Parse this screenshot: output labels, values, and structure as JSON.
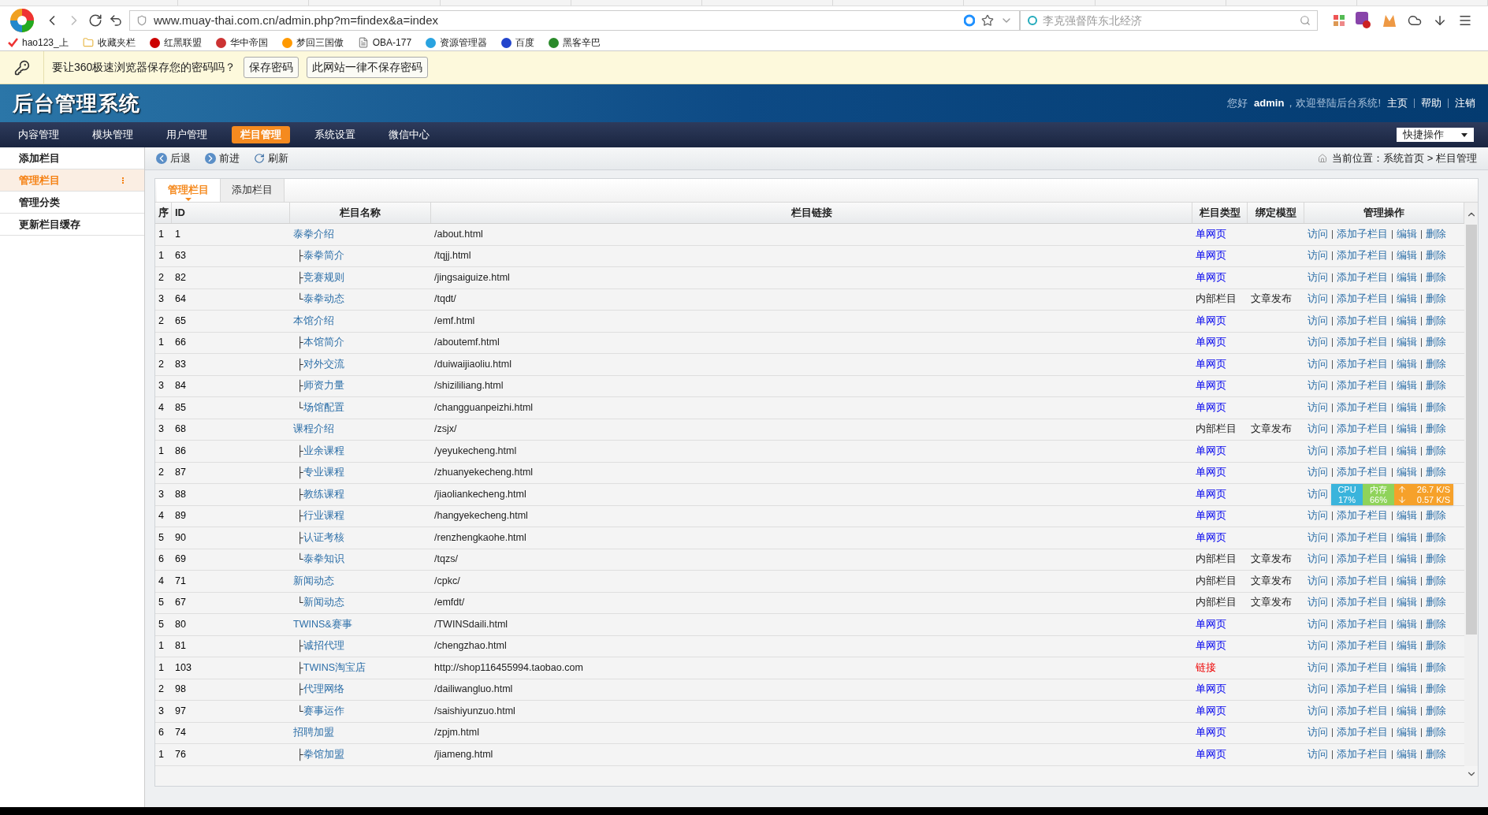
{
  "browser": {
    "url": "www.muay-thai.com.cn/admin.php?m=findex&a=index",
    "search": {
      "placeholder": "李克强督阵东北经济"
    },
    "bookmarks": [
      "hao123_上",
      "收藏夹栏",
      "红黑联盟",
      "华中帝国",
      "梦回三国傲",
      "OBA-177",
      "资源管理器",
      "百度",
      "黑客辛巴"
    ],
    "password_bar": {
      "message": "要让360极速浏览器保存您的密码吗？",
      "buttons": [
        "保存密码",
        "此网站一律不保存密码"
      ]
    }
  },
  "header": {
    "logo": "后台管理系统",
    "greeting": "您好",
    "user": "admin",
    "welcome": "，欢迎登陆后台系统!",
    "links": [
      "主页",
      "帮助",
      "注销"
    ]
  },
  "menu": [
    {
      "label": "内容管理",
      "selected": false
    },
    {
      "label": "模块管理",
      "selected": false
    },
    {
      "label": "用户管理",
      "selected": false
    },
    {
      "label": "栏目管理",
      "selected": true
    },
    {
      "label": "系统设置",
      "selected": false
    },
    {
      "label": "微信中心",
      "selected": false
    }
  ],
  "quick_action": "快捷操作",
  "sidebar": [
    {
      "label": "添加栏目",
      "selected": false
    },
    {
      "label": "管理栏目",
      "selected": true
    },
    {
      "label": "管理分类",
      "selected": false
    },
    {
      "label": "更新栏目缓存",
      "selected": false
    }
  ],
  "toolbar": {
    "buttons": [
      {
        "kind": "back",
        "label": "后退"
      },
      {
        "kind": "forward",
        "label": "前进"
      },
      {
        "kind": "refresh",
        "label": "刷新"
      }
    ],
    "breadcrumb": "当前位置：系统首页 > 栏目管理"
  },
  "tabs": [
    {
      "label": "管理栏目",
      "selected": true
    },
    {
      "label": "添加栏目",
      "selected": false
    }
  ],
  "table": {
    "columns": [
      "序",
      "ID",
      "栏目名称",
      "栏目链接",
      "栏目类型",
      "绑定模型",
      "管理操作"
    ],
    "rows": [
      {
        "seq": "1",
        "id": "1",
        "name": "泰拳介绍",
        "link": "/about.html",
        "type": {
          "text": "单网页",
          "kind": "page"
        },
        "actions": [
          "访问",
          "添加子栏目",
          "编辑",
          "删除"
        ],
        "children": [
          {
            "seq": "1",
            "id": "63",
            "name": "泰拳简介",
            "link": "/tqjj.html",
            "connector": "├",
            "type": {
              "text": "单网页",
              "kind": "page"
            },
            "actions": [
              "访问",
              "添加子栏目",
              "编辑",
              "删除"
            ]
          },
          {
            "seq": "2",
            "id": "82",
            "name": "竞赛规则",
            "link": "/jingsaiguize.html",
            "connector": "├",
            "type": {
              "text": "单网页",
              "kind": "page"
            },
            "actions": [
              "访问",
              "添加子栏目",
              "编辑",
              "删除"
            ]
          },
          {
            "seq": "3",
            "id": "64",
            "name": "泰拳动态",
            "link": "/tqdt/",
            "connector": "└",
            "type": {
              "text": "内部栏目",
              "kind": "internal"
            },
            "model": "文章发布",
            "actions": [
              "访问",
              "添加子栏目",
              "编辑",
              "删除"
            ]
          }
        ]
      },
      {
        "seq": "2",
        "id": "65",
        "name": "本馆介绍",
        "link": "/emf.html",
        "type": {
          "text": "单网页",
          "kind": "page"
        },
        "actions": [
          "访问",
          "添加子栏目",
          "编辑",
          "删除"
        ],
        "children": [
          {
            "seq": "1",
            "id": "66",
            "name": "本馆简介",
            "link": "/aboutemf.html",
            "connector": "├",
            "type": {
              "text": "单网页",
              "kind": "page"
            },
            "actions": [
              "访问",
              "添加子栏目",
              "编辑",
              "删除"
            ]
          },
          {
            "seq": "2",
            "id": "83",
            "name": "对外交流",
            "link": "/duiwaijiaoliu.html",
            "connector": "├",
            "type": {
              "text": "单网页",
              "kind": "page"
            },
            "actions": [
              "访问",
              "添加子栏目",
              "编辑",
              "删除"
            ]
          },
          {
            "seq": "3",
            "id": "84",
            "name": "师资力量",
            "link": "/shizililiang.html",
            "connector": "├",
            "type": {
              "text": "单网页",
              "kind": "page"
            },
            "actions": [
              "访问",
              "添加子栏目",
              "编辑",
              "删除"
            ]
          },
          {
            "seq": "4",
            "id": "85",
            "name": "场馆配置",
            "link": "/changguanpeizhi.html",
            "connector": "└",
            "type": {
              "text": "单网页",
              "kind": "page"
            },
            "actions": [
              "访问",
              "添加子栏目",
              "编辑",
              "删除"
            ]
          }
        ]
      },
      {
        "seq": "3",
        "id": "68",
        "name": "课程介绍",
        "link": "/zsjx/",
        "type": {
          "text": "内部栏目",
          "kind": "internal"
        },
        "model": "文章发布",
        "actions": [
          "访问",
          "添加子栏目",
          "编辑",
          "删除"
        ],
        "children": [
          {
            "seq": "1",
            "id": "86",
            "name": "业余课程",
            "link": "/yeyukecheng.html",
            "connector": "├",
            "type": {
              "text": "单网页",
              "kind": "page"
            },
            "actions": [
              "访问",
              "添加子栏目",
              "编辑",
              "删除"
            ]
          },
          {
            "seq": "2",
            "id": "87",
            "name": "专业课程",
            "link": "/zhuanyekecheng.html",
            "connector": "├",
            "type": {
              "text": "单网页",
              "kind": "page"
            },
            "actions": [
              "访问",
              "添加子栏目",
              "编辑",
              "删除"
            ]
          },
          {
            "seq": "3",
            "id": "88",
            "name": "教练课程",
            "link": "/jiaoliankecheng.html",
            "connector": "├",
            "type": {
              "text": "单网页",
              "kind": "page"
            },
            "actions": [
              "访问"
            ]
          },
          {
            "seq": "4",
            "id": "89",
            "name": "行业课程",
            "link": "/hangyekecheng.html",
            "connector": "├",
            "type": {
              "text": "单网页",
              "kind": "page"
            },
            "actions": [
              "访问",
              "添加子栏目",
              "编辑",
              "删除"
            ]
          },
          {
            "seq": "5",
            "id": "90",
            "name": "认证考核",
            "link": "/renzhengkaohe.html",
            "connector": "├",
            "type": {
              "text": "单网页",
              "kind": "page"
            },
            "actions": [
              "访问",
              "添加子栏目",
              "编辑",
              "删除"
            ]
          },
          {
            "seq": "6",
            "id": "69",
            "name": "泰拳知识",
            "link": "/tqzs/",
            "connector": "└",
            "type": {
              "text": "内部栏目",
              "kind": "internal"
            },
            "model": "文章发布",
            "actions": [
              "访问",
              "添加子栏目",
              "编辑",
              "删除"
            ]
          }
        ]
      },
      {
        "seq": "4",
        "id": "71",
        "name": "新闻动态",
        "link": "/cpkc/",
        "type": {
          "text": "内部栏目",
          "kind": "internal"
        },
        "model": "文章发布",
        "actions": [
          "访问",
          "添加子栏目",
          "编辑",
          "删除"
        ],
        "children": [
          {
            "seq": "5",
            "id": "67",
            "name": "新闻动态",
            "link": "/emfdt/",
            "connector": "└",
            "type": {
              "text": "内部栏目",
              "kind": "internal"
            },
            "model": "文章发布",
            "actions": [
              "访问",
              "添加子栏目",
              "编辑",
              "删除"
            ]
          }
        ]
      },
      {
        "seq": "5",
        "id": "80",
        "name": "TWINS&赛事",
        "link": "/TWINSdaili.html",
        "type": {
          "text": "单网页",
          "kind": "page"
        },
        "actions": [
          "访问",
          "添加子栏目",
          "编辑",
          "删除"
        ],
        "children": [
          {
            "seq": "1",
            "id": "81",
            "name": "诚招代理",
            "link": "/chengzhao.html",
            "connector": "├",
            "type": {
              "text": "单网页",
              "kind": "page"
            },
            "actions": [
              "访问",
              "添加子栏目",
              "编辑",
              "删除"
            ]
          },
          {
            "seq": "1",
            "id": "103",
            "name": "TWINS淘宝店",
            "link": "http://shop116455994.taobao.com",
            "connector": "├",
            "type": {
              "text": "链接",
              "kind": "link"
            },
            "actions": [
              "访问",
              "添加子栏目",
              "编辑",
              "删除"
            ]
          },
          {
            "seq": "2",
            "id": "98",
            "name": "代理网络",
            "link": "/dailiwangluo.html",
            "connector": "├",
            "type": {
              "text": "单网页",
              "kind": "page"
            },
            "actions": [
              "访问",
              "添加子栏目",
              "编辑",
              "删除"
            ]
          },
          {
            "seq": "3",
            "id": "97",
            "name": "赛事运作",
            "link": "/saishiyunzuo.html",
            "connector": "└",
            "type": {
              "text": "单网页",
              "kind": "page"
            },
            "actions": [
              "访问",
              "添加子栏目",
              "编辑",
              "删除"
            ]
          }
        ]
      },
      {
        "seq": "6",
        "id": "74",
        "name": "招聘加盟",
        "link": "/zpjm.html",
        "type": {
          "text": "单网页",
          "kind": "page"
        },
        "actions": [
          "访问",
          "添加子栏目",
          "编辑",
          "删除"
        ],
        "children": [
          {
            "seq": "1",
            "id": "76",
            "name": "拳馆加盟",
            "link": "/jiameng.html",
            "connector": "├",
            "type": {
              "text": "单网页",
              "kind": "page"
            },
            "actions": [
              "访问",
              "添加子栏目",
              "编辑",
              "删除"
            ]
          }
        ]
      }
    ]
  },
  "monitor": {
    "cpu_label": "CPU",
    "cpu": "17%",
    "mem_label": "内存",
    "mem": "66%",
    "up": "26.7 K/S",
    "down": "0.57 K/S"
  }
}
